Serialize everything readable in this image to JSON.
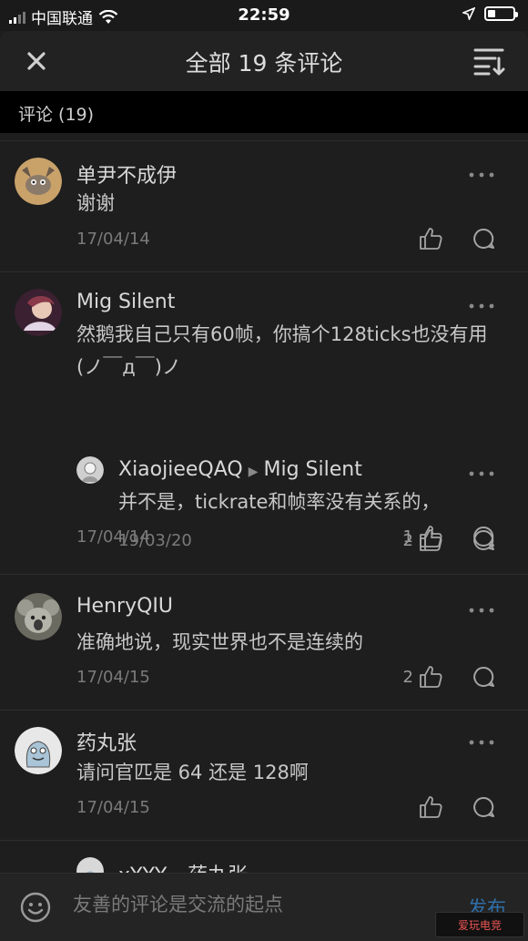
{
  "status_bar": {
    "carrier": "中国联通",
    "time": "22:59",
    "battery_level": 0.3
  },
  "header": {
    "title": "全部 19 条评论"
  },
  "section": {
    "label": "评论 (19)"
  },
  "comments": [
    {
      "user": "单尹不成伊",
      "text": "谢谢",
      "date": "17/04/14",
      "likes": ""
    },
    {
      "user": "Mig Silent",
      "text": "然鹅我自己只有60帧，你搞个128ticks也没有用(ノ￣д￣)ノ",
      "date": "17/04/14",
      "likes": "1"
    },
    {
      "user": "XiaojieeQAQ",
      "reply_to": "Mig Silent",
      "text": "并不是，tickrate和帧率没有关系的，",
      "date": "19/03/20",
      "likes": "2"
    },
    {
      "user": "HenryQIU",
      "text": "准确地说，现实世界也不是连续的",
      "date": "17/04/15",
      "likes": "2"
    },
    {
      "user": "药丸张",
      "text": "请问官匹是 64 还是 128啊",
      "date": "17/04/15",
      "likes": ""
    },
    {
      "user": "xYYY",
      "reply_to": "药丸张"
    }
  ],
  "bottom_bar": {
    "placeholder": "友善的评论是交流的起点",
    "send_label": "发布"
  },
  "watermark": "爱玩电竞",
  "colors": {
    "accent": "#2f6fa8",
    "background": "#1e1e1e"
  }
}
